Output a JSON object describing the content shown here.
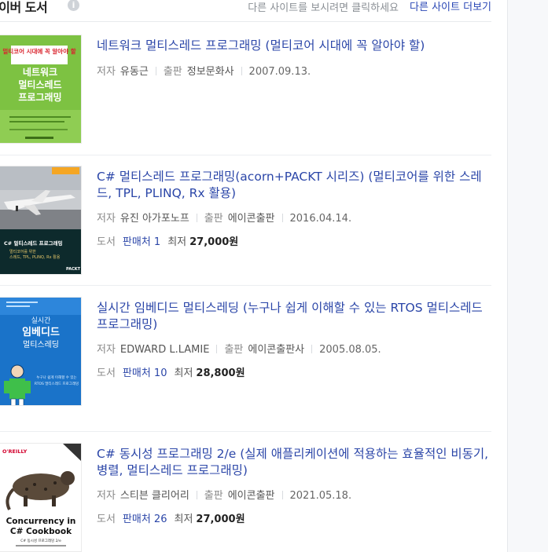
{
  "header": {
    "title": "네이버 도서",
    "info_icon": "i",
    "hint": "다른 사이트를 보시려면 클릭하세요",
    "more_link": "다른 사이트 더보기"
  },
  "labels": {
    "author": "저자",
    "publisher": "출판",
    "store": "도서",
    "lowest": "최저"
  },
  "books": [
    {
      "title": "네트워크 멀티스레드 프로그래밍 (멀티코어 시대에 꼭 알아야 할)",
      "author": "유동근",
      "publisher": "정보문화사",
      "date": "2007.09.13.",
      "cover": {
        "top_text": "멀티코어 시대에 꼭 알아야 할",
        "title_line1": "네트워크",
        "title_line2": "멀티스레드",
        "title_line3": "프로그래밍",
        "bg": "#7dc242"
      }
    },
    {
      "title": "C# 멀티스레드 프로그래밍(acorn+PACKT 시리즈) (멀티코어를 위한 스레드, TPL, PLINQ, Rx 활용)",
      "author": "유진 아가포노프",
      "publisher": "에이콘출판",
      "date": "2016.04.14.",
      "sellers": "판매처 1",
      "price": "27,000원",
      "cover": {
        "title_line1": "C# 멀티스레드 프로그래밍",
        "sub_line1": "멀티코어를 위한",
        "sub_line2": "스레드, TPL, PLINQ, Rx 활용",
        "badge": "PACKT",
        "bg": "#0d2a2c"
      }
    },
    {
      "title": "실시간 임베디드 멀티스레딩 (누구나 쉽게 이해할 수 있는 RTOS 멀티스레드 프로그래밍)",
      "author": "EDWARD L.LAMIE",
      "publisher": "에이콘출판사",
      "date": "2005.08.05.",
      "sellers": "판매처 10",
      "price": "28,800원",
      "cover": {
        "title_line1": "실시간",
        "title_line2": "임베디드",
        "title_line3": "멀티스레딩",
        "sub_line1": "누구나 쉽게 이해할 수 있는",
        "sub_line2": "RTOS 멀티스레드 프로그래밍",
        "bg": "#1a73c9"
      }
    },
    {
      "title": "C# 동시성 프로그래밍 2/e (실제 애플리케이션에 적용하는 효율적인 비동기, 병렬, 멀티스레드 프로그래밍)",
      "author": "스티븐 클리어리",
      "publisher": "에이콘출판",
      "date": "2021.05.18.",
      "sellers": "판매처 26",
      "price": "27,000원",
      "cover": {
        "brand": "O'REILLY",
        "title_line1": "Concurrency in",
        "title_line2": "C# Cookbook",
        "sub_line1": "C# 동시성 프로그래밍 2/e",
        "bg": "#ffffff"
      }
    }
  ]
}
